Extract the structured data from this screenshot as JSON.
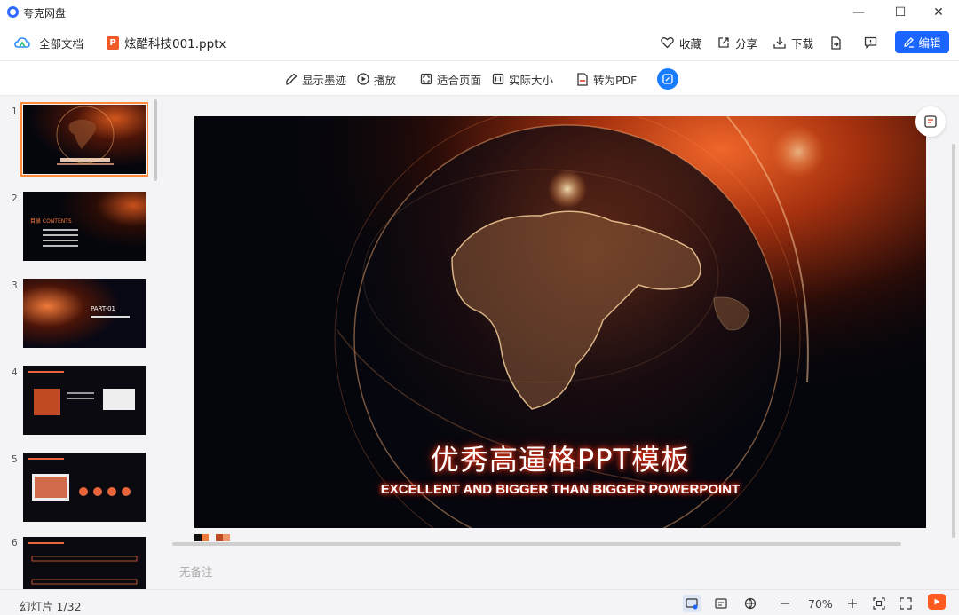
{
  "window": {
    "app_name": "夸克网盘",
    "controls": {
      "minimize": "—",
      "maximize": "☐",
      "close": "✕"
    }
  },
  "header": {
    "all_docs_label": "全部文档",
    "file_name": "炫酷科技001.pptx",
    "file_badge": "P",
    "favorite_label": "收藏",
    "share_label": "分享",
    "download_label": "下载",
    "edit_label": "编辑"
  },
  "viewbar": {
    "show_ink_label": "显示墨迹",
    "play_label": "播放",
    "fit_page_label": "适合页面",
    "actual_size_label": "实际大小",
    "to_pdf_label": "转为PDF"
  },
  "thumbnails": [
    {
      "num": "1",
      "active": true
    },
    {
      "num": "2",
      "heading": "目录 CONTENTS"
    },
    {
      "num": "3",
      "part": "PART-01"
    },
    {
      "num": "4"
    },
    {
      "num": "5"
    },
    {
      "num": "6"
    }
  ],
  "slide": {
    "title": "优秀高逼格PPT模板",
    "subtitle": "EXCELLENT AND BIGGER THAN BIGGER POWERPOINT"
  },
  "notes": {
    "placeholder": "无备注"
  },
  "statusbar": {
    "slide_counter": "幻灯片 1/32",
    "zoom": "70%"
  },
  "colors": {
    "accent": "#1a66ff",
    "thumb_active": "#ff8a3a",
    "play": "#ff5a1f"
  }
}
